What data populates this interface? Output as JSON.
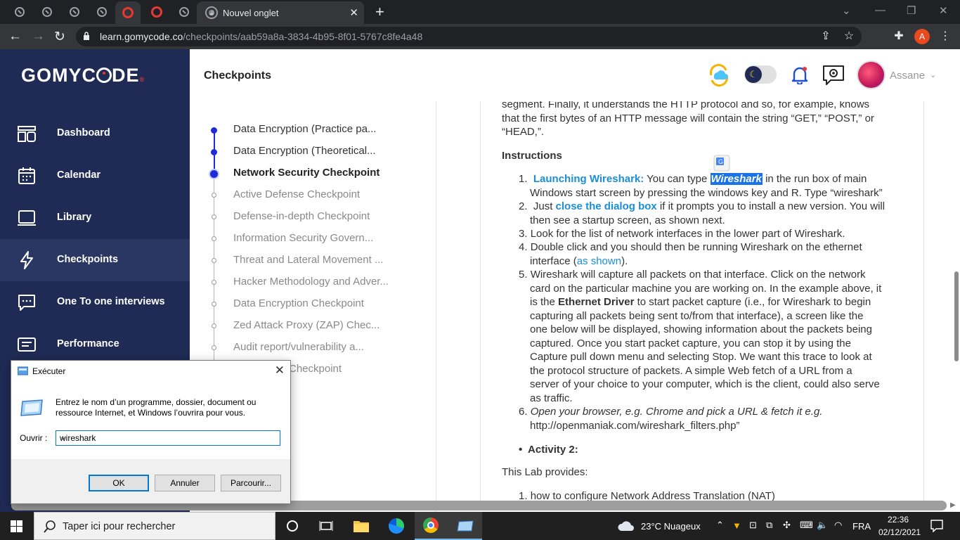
{
  "browser": {
    "active_tab_title": "Nouvel onglet",
    "url_domain": "learn.gomycode.co",
    "url_path": "/checkpoints/aab59a8a-3834-4b95-8f01-5767c8fe4a48",
    "profile_initial": "A"
  },
  "sidebar": {
    "logo": "GOMYC",
    "logo_o": "O",
    "logo_rest": "DE",
    "items": [
      {
        "label": "Dashboard",
        "icon": "dashboard-icon"
      },
      {
        "label": "Calendar",
        "icon": "calendar-icon"
      },
      {
        "label": "Library",
        "icon": "library-icon"
      },
      {
        "label": "Checkpoints",
        "icon": "lightning-icon",
        "active": true
      },
      {
        "label": "One To one interviews",
        "icon": "chat-icon"
      },
      {
        "label": "Performance",
        "icon": "performance-icon"
      }
    ]
  },
  "header": {
    "title": "Checkpoints",
    "user_name": "Assane"
  },
  "timeline": [
    {
      "label": "Data Encryption (Practice pa...",
      "state": "done"
    },
    {
      "label": "Data Encryption (Theoretical...",
      "state": "done"
    },
    {
      "label": "Network Security Checkpoint",
      "state": "current"
    },
    {
      "label": "Active Defense Checkpoint",
      "state": "todo"
    },
    {
      "label": "Defense-in-depth Checkpoint",
      "state": "todo"
    },
    {
      "label": "Information Security Govern...",
      "state": "todo"
    },
    {
      "label": "Threat and Lateral Movement ...",
      "state": "todo"
    },
    {
      "label": "Hacker Methodology and Adver...",
      "state": "todo"
    },
    {
      "label": "Data Encryption Checkpoint",
      "state": "todo"
    },
    {
      "label": "Zed Attack Proxy (ZAP) Chec...",
      "state": "todo"
    },
    {
      "label": "Audit report/vulnerability a...",
      "state": "todo"
    },
    {
      "label": "Checkpoint",
      "state": "todo"
    }
  ],
  "content": {
    "intro_1": "segment. Finally, it understands the HTTP protocol and so, for example, knows",
    "intro_2": "that the first bytes of an HTTP message will contain the string “GET,” “POST,” or",
    "intro_3": "“HEAD,”.",
    "instructions_heading": "Instructions",
    "s1_bold": "Launching Wireshark:",
    "s1_text": " You can type ",
    "s1_highlight": "Wireshark",
    "s1_rest": " in the run box of main",
    "s1_line2": "Windows start screen by pressing the windows key and R. Type “wireshark”",
    "s2_pre": "Just ",
    "s2_link": "close the dialog box",
    "s2_rest": " if it prompts you to install a new version. You will",
    "s2_line2": "then see a startup screen, as shown next.",
    "s3": "Look for the list of network interfaces in the lower part of Wireshark.",
    "s4_line1": "Double click and you should then be running Wireshark on the ethernet",
    "s4_pre": "interface (",
    "s4_link": "as shown",
    "s4_post": ").",
    "s5_lines": [
      "Wireshark will capture all packets on that interface. Click on the network",
      "card on the particular machine you are working on. In the example above, it"
    ],
    "s5_pre": "is the ",
    "s5_bold": "Ethernet Driver",
    "s5_post": " to start packet capture (i.e., for Wireshark to begin",
    "s5_more": [
      "capturing all packets being sent to/from that interface), a screen like the",
      "one below will be displayed, showing information about the packets being",
      "captured. Once you start packet capture, you can stop it by using the",
      "Capture pull down menu and selecting Stop. We want this trace to look at",
      "the protocol structure of packets. A simple Web fetch of a URL from a",
      "server of your choice to your computer, which is the client, could also serve",
      "as traffic."
    ],
    "s6_line1": "Open your browser, e.g. Chrome and pick a URL & fetch it e.g.",
    "s6_line2": "http://openmaniak.com/wireshark_filters.php”",
    "activity": "Activity 2:",
    "lab": "This Lab provides:",
    "lab_item": "how to configure Network Address Translation (NAT)"
  },
  "run_dialog": {
    "title": "Exécuter",
    "description": "Entrez le nom d’un programme, dossier, document ou ressource Internet, et Windows l’ouvrira pour vous.",
    "open_label": "Ouvrir :",
    "open_value": "wireshark",
    "ok": "OK",
    "cancel": "Annuler",
    "browse": "Parcourir..."
  },
  "taskbar": {
    "search_placeholder": "Taper ici pour rechercher",
    "weather": "23°C  Nuageux",
    "lang": "FRA",
    "time": "22:36",
    "date": "02/12/2021"
  }
}
